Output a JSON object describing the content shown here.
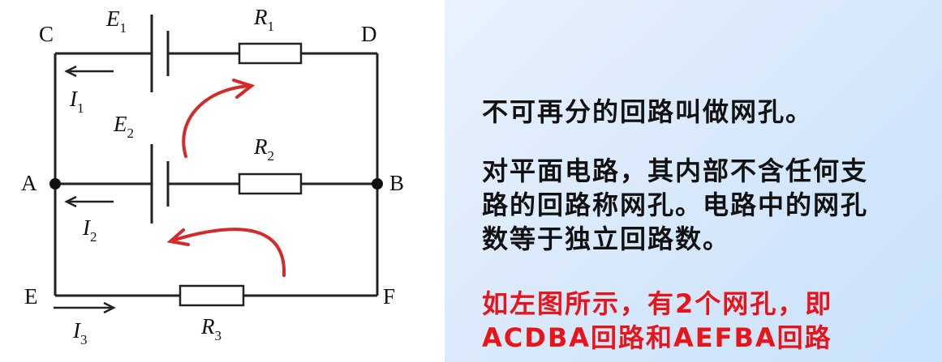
{
  "diagram": {
    "nodes": {
      "C": "C",
      "D": "D",
      "A": "A",
      "B": "B",
      "E": "E",
      "F": "F"
    },
    "sources": [
      {
        "label": "E",
        "sub": "1"
      },
      {
        "label": "E",
        "sub": "2"
      }
    ],
    "resistors": [
      {
        "label": "R",
        "sub": "1"
      },
      {
        "label": "R",
        "sub": "2"
      },
      {
        "label": "R",
        "sub": "3"
      }
    ],
    "currents": [
      {
        "label": "I",
        "sub": "1"
      },
      {
        "label": "I",
        "sub": "2"
      },
      {
        "label": "I",
        "sub": "3"
      }
    ],
    "mesh_arrow_color": "#d42a2a",
    "wire_color": "#222222"
  },
  "text": {
    "definition1": "不可再分的回路叫做网孔。",
    "definition2_lines": [
      "对平面电路，其内部不含任何支",
      "路的回路称网孔。电路中的网孔",
      "数等于独立回路数。"
    ],
    "example_lines": [
      "如左图所示，有2个网孔，即",
      "ACDBA回路和AEFBA回路"
    ],
    "example_color": "#e8141a"
  }
}
